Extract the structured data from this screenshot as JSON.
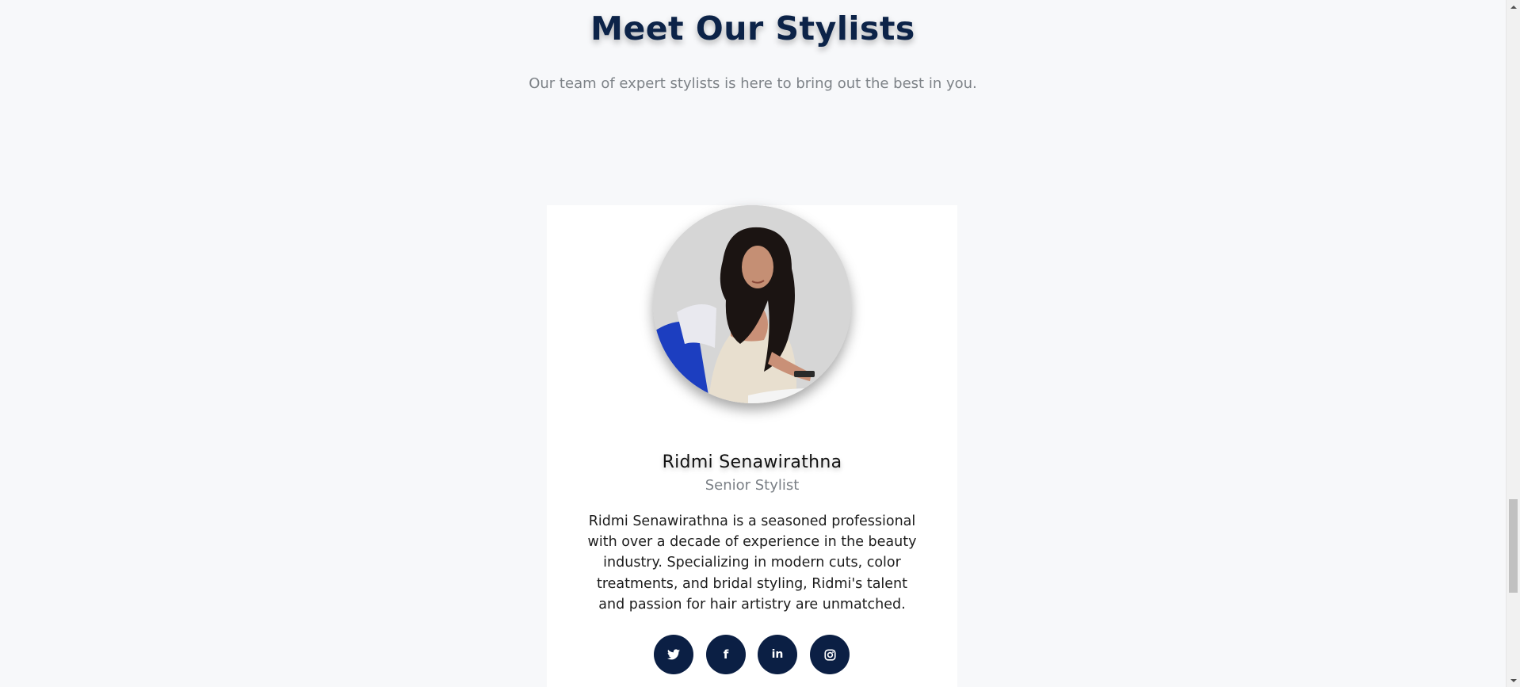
{
  "section": {
    "title": "Meet Our Stylists",
    "subtitle": "Our team of expert stylists is here to bring out the best in you."
  },
  "stylist": {
    "name": "Ridmi Senawirathna",
    "role": "Senior Stylist",
    "bio": "Ridmi Senawirathna is a seasoned professional with over a decade of experience in the beauty industry. Specializing in modern cuts, color treatments, and bridal styling, Ridmi's talent and passion for hair artistry are unmatched.",
    "photo_alt": "Ridmi Senawirathna",
    "socials": [
      {
        "network": "twitter",
        "icon": "twitter-icon",
        "glyph": "🐦"
      },
      {
        "network": "facebook",
        "icon": "facebook-icon",
        "glyph": "f"
      },
      {
        "network": "linkedin",
        "icon": "linkedin-icon",
        "glyph": "in"
      },
      {
        "network": "instagram",
        "icon": "instagram-icon",
        "glyph": "◎"
      }
    ]
  },
  "colors": {
    "title": "#0c2348",
    "social_button": "#0b1f44",
    "background": "#f7f8fa"
  }
}
